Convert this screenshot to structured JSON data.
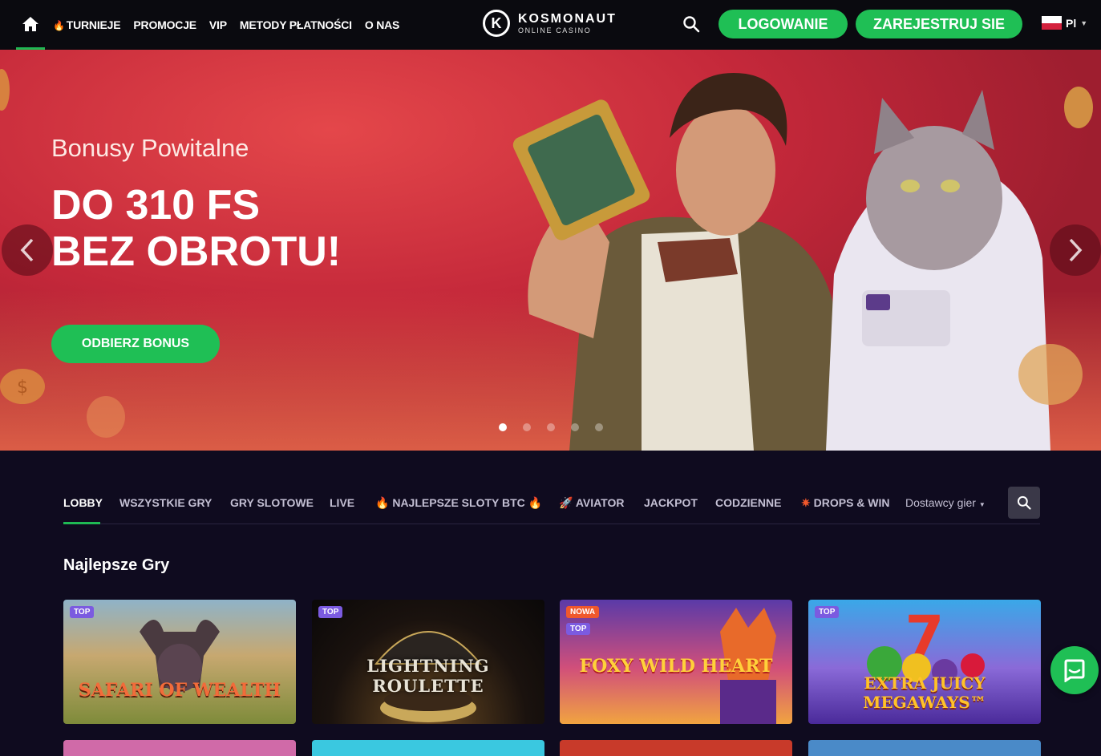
{
  "header": {
    "nav": [
      "TURNIEJE",
      "PROMOCJE",
      "VIP",
      "METODY PŁATNOŚCI",
      "O NAS"
    ],
    "logo_name": "KOSMONAUT",
    "logo_sub": "ONLINE CASINO",
    "login": "LOGOWANIE",
    "register": "ZAREJESTRUJ SIE",
    "lang": "Pl"
  },
  "hero": {
    "subtitle": "Bonusy Powitalne",
    "title": "DO 310 FS\nBEZ OBROTU!",
    "cta": "ODBIERZ BONUS",
    "slides": 5,
    "active_slide": 1
  },
  "tabs": [
    "LOBBY",
    "WSZYSTKIE GRY",
    "GRY SLOTOWE",
    "LIVE",
    "NAJLEPSZE SLOTY BTC",
    "AVIATOR",
    "JACKPOT",
    "CODZIENNE",
    "DROPS & WIN"
  ],
  "providers": "Dostawcy gier",
  "section_title": "Najlepsze Gry",
  "games": [
    {
      "title": "SAFARI OF WEALTH",
      "badges": [
        "TOP"
      ]
    },
    {
      "title": "LIGHTNING ROULETTE",
      "badges": [
        "TOP"
      ]
    },
    {
      "title": "FOXY WILD HEART",
      "badges": [
        "NOWA",
        "TOP"
      ]
    },
    {
      "title": "EXTRA JUICY MEGAWAYS™",
      "badges": [
        "TOP"
      ]
    }
  ],
  "colors": {
    "accent": "#1fbf55",
    "background": "#0f0b1f",
    "hero": "#c4283a"
  }
}
